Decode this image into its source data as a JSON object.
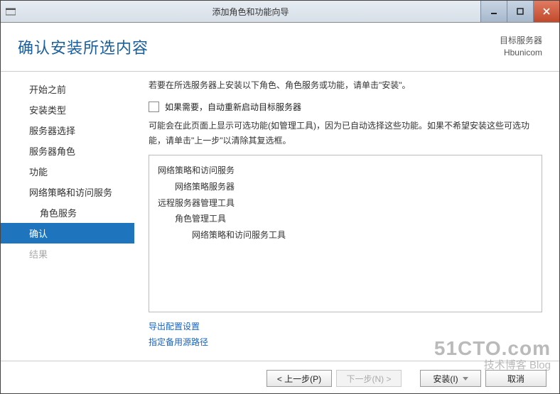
{
  "window": {
    "title": "添加角色和功能向导"
  },
  "header": {
    "page_title": "确认安装所选内容",
    "target_label": "目标服务器",
    "target_server": "Hbunicom"
  },
  "sidebar": {
    "steps": [
      {
        "label": "开始之前",
        "indent": 0,
        "state": "normal"
      },
      {
        "label": "安装类型",
        "indent": 0,
        "state": "normal"
      },
      {
        "label": "服务器选择",
        "indent": 0,
        "state": "normal"
      },
      {
        "label": "服务器角色",
        "indent": 0,
        "state": "normal"
      },
      {
        "label": "功能",
        "indent": 0,
        "state": "normal"
      },
      {
        "label": "网络策略和访问服务",
        "indent": 0,
        "state": "normal"
      },
      {
        "label": "角色服务",
        "indent": 1,
        "state": "normal"
      },
      {
        "label": "确认",
        "indent": 0,
        "state": "active"
      },
      {
        "label": "结果",
        "indent": 0,
        "state": "disabled"
      }
    ]
  },
  "content": {
    "intro_text": "若要在所选服务器上安装以下角色、角色服务或功能，请单击\"安装\"。",
    "restart_checkbox": {
      "checked": false,
      "label": "如果需要，自动重新启动目标服务器"
    },
    "note_text": "可能会在此页面上显示可选功能(如管理工具)，因为已自动选择这些功能。如果不希望安装这些可选功能，请单击\"上一步\"以清除其复选框。",
    "selections": [
      {
        "text": "网络策略和访问服务",
        "level": 1
      },
      {
        "text": "网络策略服务器",
        "level": 2
      },
      {
        "text": "远程服务器管理工具",
        "level": 1
      },
      {
        "text": "角色管理工具",
        "level": 2
      },
      {
        "text": "网络策略和访问服务工具",
        "level": 3
      }
    ],
    "export_link": "导出配置设置",
    "altsrc_link": "指定备用源路径"
  },
  "footer": {
    "prev": "< 上一步(P)",
    "next": "下一步(N) >",
    "install": "安装(I)",
    "cancel": "取消"
  },
  "watermark": {
    "url": "51CTO.com",
    "sub": "技术博客  Blog"
  }
}
